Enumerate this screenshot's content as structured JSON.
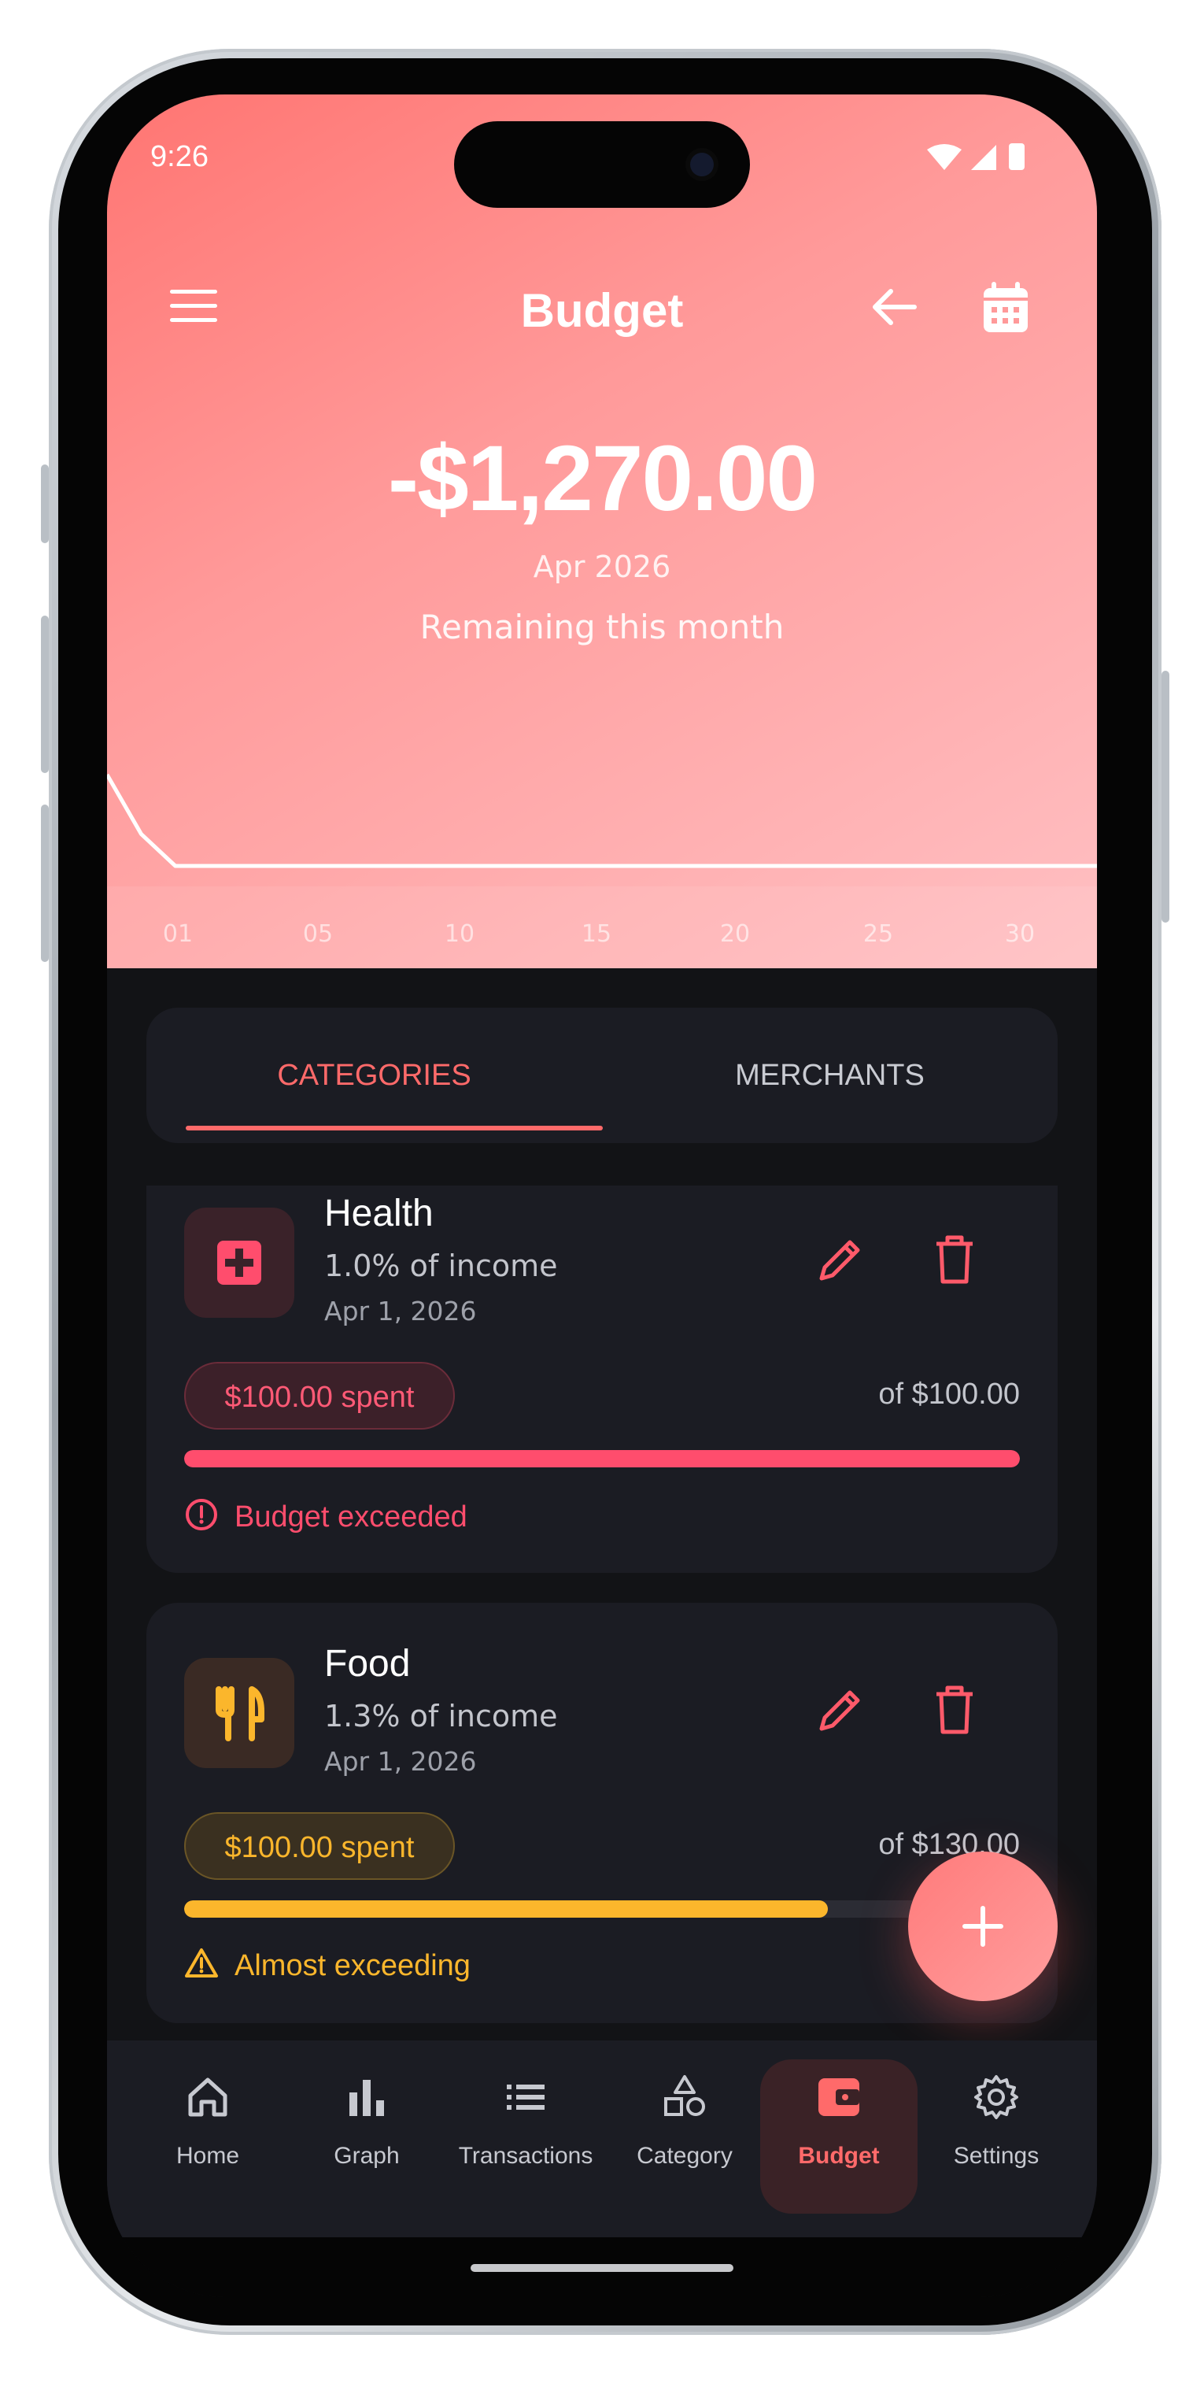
{
  "status": {
    "time": "9:26"
  },
  "header": {
    "title": "Budget",
    "amount": "-$1,270.00",
    "month": "Apr 2026",
    "remaining_label": "Remaining this month"
  },
  "chart_data": {
    "type": "line",
    "x": [
      1,
      2,
      3,
      4,
      5,
      10,
      15,
      20,
      25,
      30
    ],
    "values": [
      1.0,
      0.35,
      0.0,
      0.0,
      0.0,
      0.0,
      0.0,
      0.0,
      0.0,
      0.0
    ],
    "xticks": [
      "01",
      "05",
      "10",
      "15",
      "20",
      "25",
      "30"
    ],
    "grid": false
  },
  "tabs": [
    {
      "label": "CATEGORIES",
      "active": true
    },
    {
      "label": "MERCHANTS",
      "active": false
    }
  ],
  "budgets": [
    {
      "name": "Health",
      "pct_income": "1.0% of income",
      "date": "Apr 1, 2026",
      "spent": "$100.00 spent",
      "of": "of $100.00",
      "progress": 1.0,
      "status": "Budget exceeded",
      "color": "#ff4d6d",
      "icon": "medical-cross-icon"
    },
    {
      "name": "Food",
      "pct_income": "1.3% of income",
      "date": "Apr 1, 2026",
      "spent": "$100.00 spent",
      "of": "of $130.00",
      "progress": 0.77,
      "status": "Almost exceeding",
      "color": "#fbb62c",
      "icon": "fork-knife-icon"
    }
  ],
  "nav": [
    {
      "label": "Home",
      "icon": "home-icon"
    },
    {
      "label": "Graph",
      "icon": "bar-chart-icon"
    },
    {
      "label": "Transactions",
      "icon": "list-icon"
    },
    {
      "label": "Category",
      "icon": "shapes-icon"
    },
    {
      "label": "Budget",
      "icon": "wallet-icon",
      "active": true
    },
    {
      "label": "Settings",
      "icon": "gear-icon"
    }
  ],
  "colors": {
    "accent": "#ff6a6a",
    "card": "#1b1c23",
    "background": "#121316"
  }
}
